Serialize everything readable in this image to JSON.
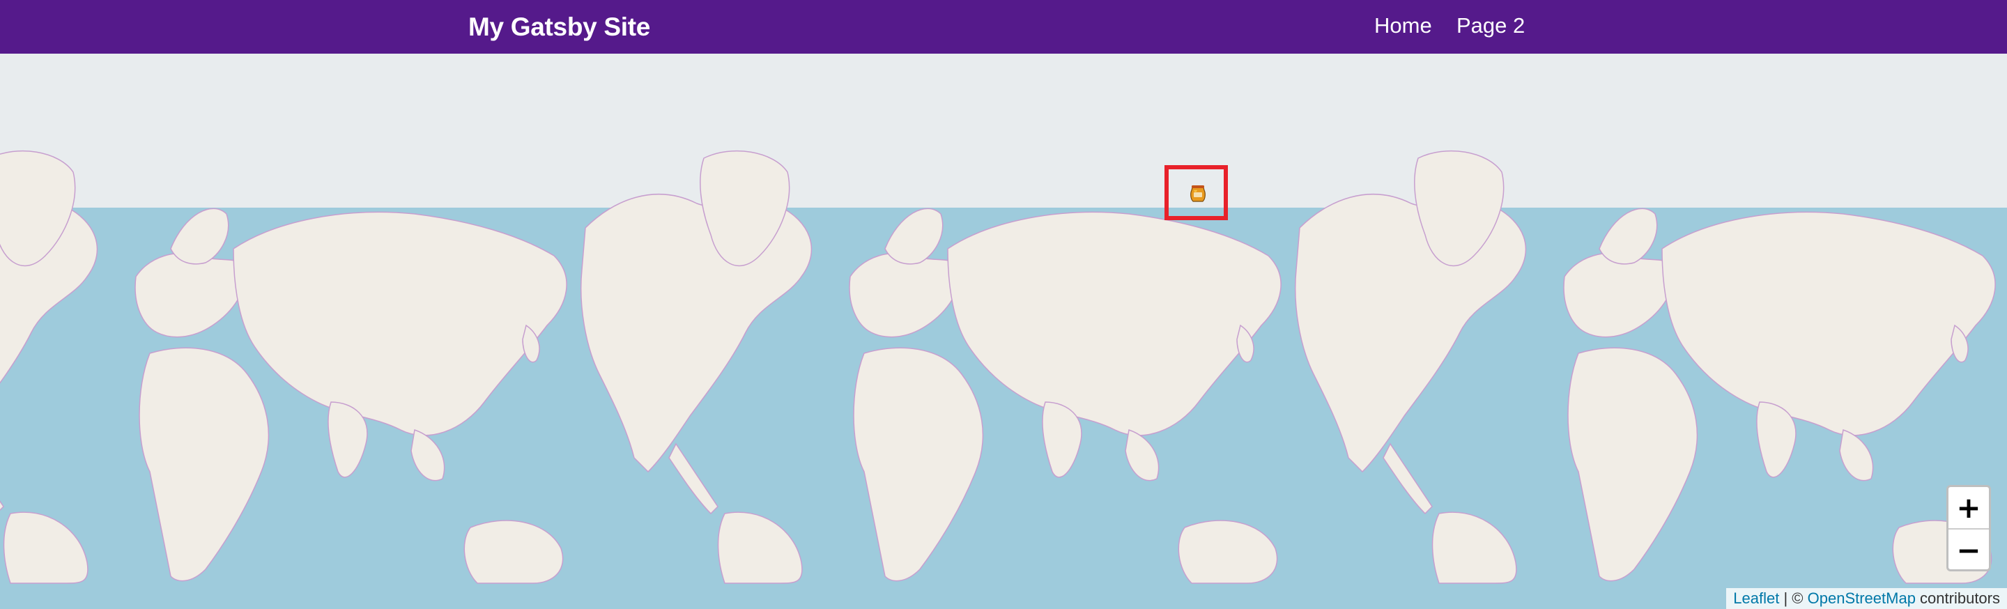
{
  "header": {
    "brand": "My Gatsby Site",
    "nav": [
      {
        "label": "Home"
      },
      {
        "label": "Page 2"
      }
    ],
    "background_color": "#551a8b"
  },
  "map": {
    "ocean_color": "#9ecbdc",
    "land_color": "#f1ede6",
    "border_color": "#c79fcf",
    "offmap_color": "#e8ecee",
    "marker": {
      "icon": "honey-pot-icon",
      "highlight_color": "#e8212a"
    },
    "zoom": {
      "in_label": "+",
      "out_label": "−"
    },
    "attribution": {
      "leaflet": "Leaflet",
      "separator": " | © ",
      "osm": "OpenStreetMap",
      "suffix": " contributors"
    }
  }
}
